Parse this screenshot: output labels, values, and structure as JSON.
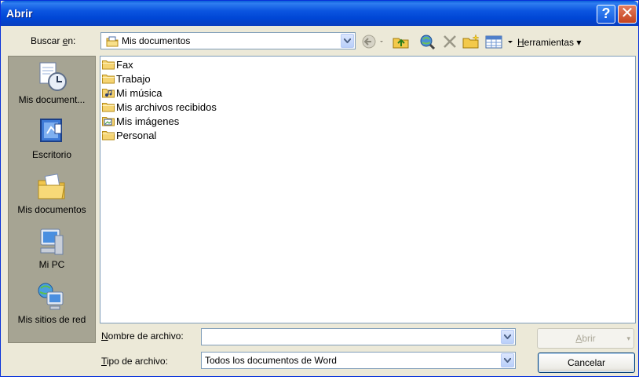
{
  "window": {
    "title": "Abrir",
    "help_glyph": "?",
    "close_glyph": "✕"
  },
  "toolbar": {
    "lookin_label_pre": "Buscar ",
    "lookin_label_key": "e",
    "lookin_label_post": "n:",
    "lookin_value": "Mis documentos",
    "tools_label_key": "H",
    "tools_label_rest": "erramientas",
    "tools_arrow": "▾"
  },
  "places": [
    {
      "label": "Mis document...",
      "icon": "recent-documents-icon"
    },
    {
      "label": "Escritorio",
      "icon": "desktop-icon"
    },
    {
      "label": "Mis documentos",
      "icon": "my-documents-icon"
    },
    {
      "label": "Mi PC",
      "icon": "my-computer-icon"
    },
    {
      "label": "Mis sitios de red",
      "icon": "network-places-icon"
    }
  ],
  "files": [
    {
      "name": "Fax",
      "icon": "folder-icon"
    },
    {
      "name": "Trabajo",
      "icon": "folder-icon"
    },
    {
      "name": "Mi música",
      "icon": "music-folder-icon"
    },
    {
      "name": "Mis archivos recibidos",
      "icon": "folder-icon"
    },
    {
      "name": "Mis imágenes",
      "icon": "pictures-folder-icon"
    },
    {
      "name": "Personal",
      "icon": "folder-icon"
    }
  ],
  "fields": {
    "filename_label_key": "N",
    "filename_label_rest": "ombre de archivo:",
    "filename_value": "",
    "filetype_label_key": "T",
    "filetype_label_rest": "ipo de archivo:",
    "filetype_value": "Todos los documentos de Word"
  },
  "buttons": {
    "open_key": "A",
    "open_rest": "brir",
    "open_arrow": "▾",
    "cancel": "Cancelar"
  },
  "colors": {
    "titlebar": "#0046d5",
    "dialog_bg": "#ece9d8",
    "places_bg": "#a6a493",
    "border": "#7f9db9"
  }
}
